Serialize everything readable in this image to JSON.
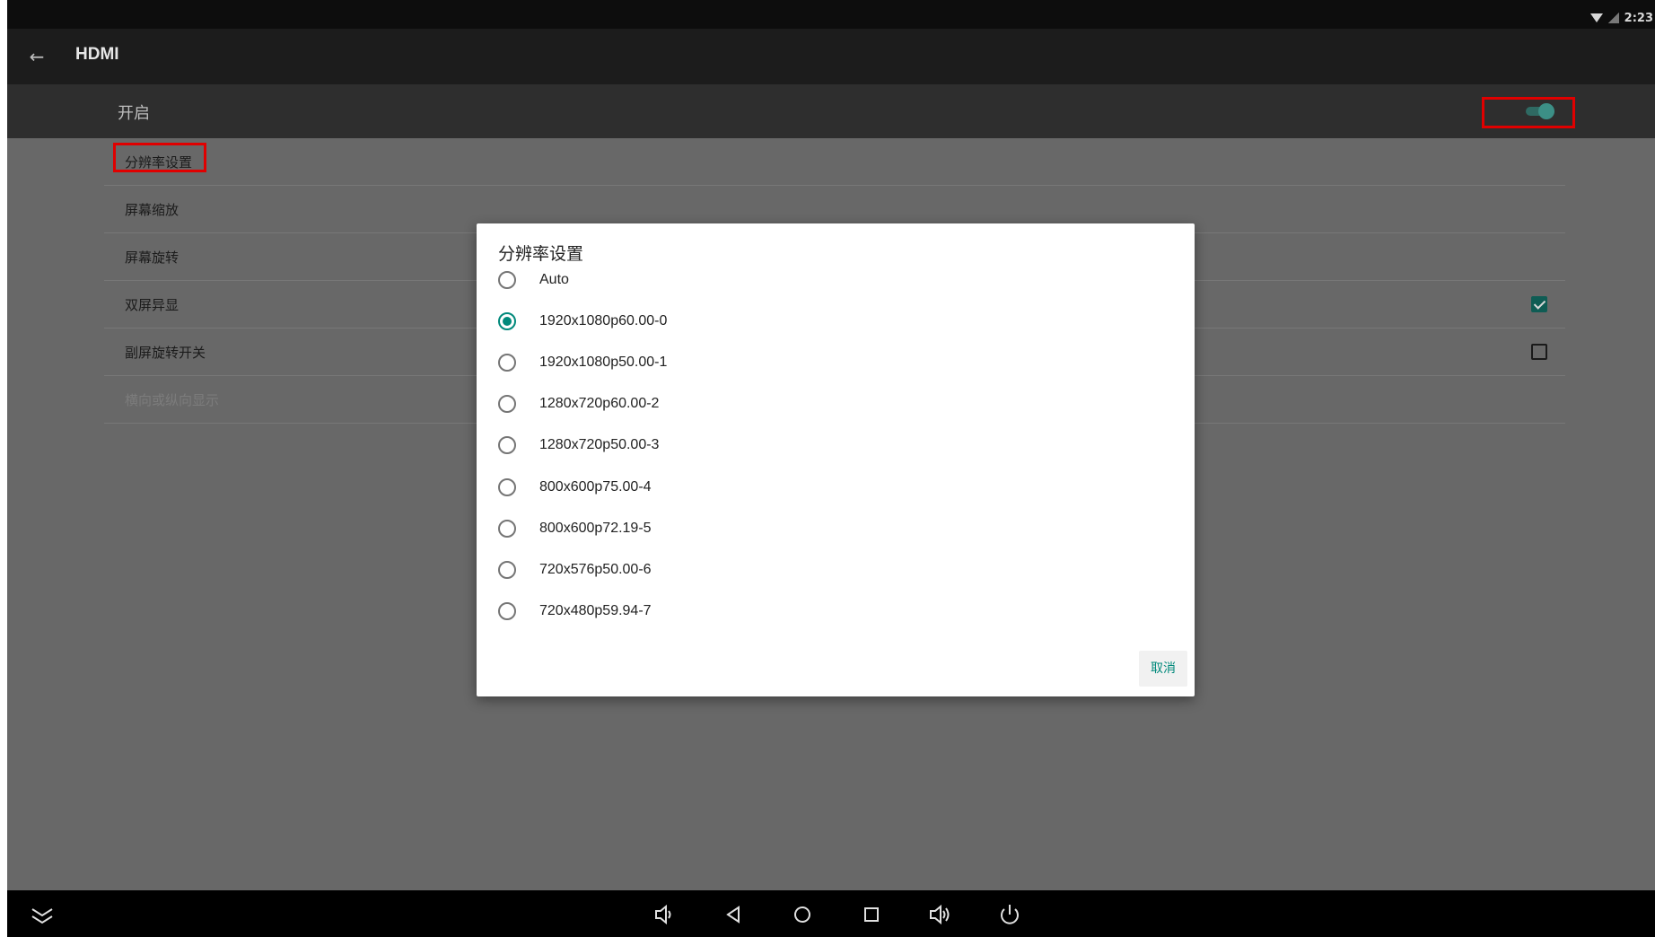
{
  "status_bar": {
    "time": "2:23"
  },
  "action_bar": {
    "back_glyph": "←",
    "title": "HDMI"
  },
  "switch_bar": {
    "label": "开启",
    "enabled": true
  },
  "preferences": [
    {
      "label": "分辨率设置",
      "highlighted": true
    },
    {
      "label": "屏幕缩放"
    },
    {
      "label": "屏幕旋转"
    },
    {
      "label": "双屏异显",
      "checkbox": true,
      "checked": true
    },
    {
      "label": "副屏旋转开关",
      "checkbox": true,
      "checked": false
    },
    {
      "label": "横向或纵向显示",
      "disabled": true
    }
  ],
  "dialog": {
    "title": "分辨率设置",
    "selected_index": 1,
    "options": [
      "Auto",
      "1920x1080p60.00-0",
      "1920x1080p50.00-1",
      "1280x720p60.00-2",
      "1280x720p50.00-3",
      "800x600p75.00-4",
      "800x600p72.19-5",
      "720x576p50.00-6",
      "720x480p59.94-7"
    ],
    "cancel_label": "取消"
  },
  "nav_bar": {
    "buttons": [
      "collapse-icon",
      "volume-down-icon",
      "back-icon",
      "home-icon",
      "recents-icon",
      "volume-up-icon",
      "power-icon"
    ]
  },
  "colors": {
    "accent": "#00897b",
    "highlight_box": "#e00000",
    "dim_overlay": "#686868"
  }
}
